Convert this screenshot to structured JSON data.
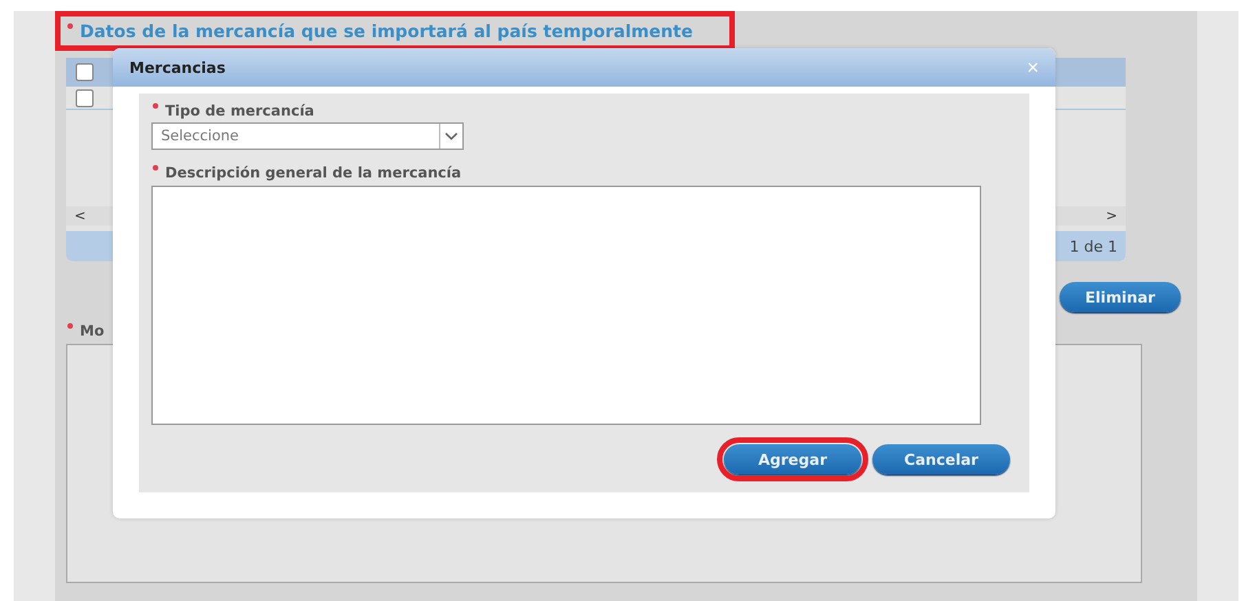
{
  "section": {
    "title": "Datos de la mercancía que se importará al país temporalmente",
    "required": true,
    "highlighted": true
  },
  "table": {
    "header_checkbox": {
      "checked": false
    },
    "rows": [
      {
        "checked": false
      }
    ],
    "pager": "1 de 1",
    "scroll_left": "<",
    "scroll_right": ">"
  },
  "delete_button": "Eliminar",
  "motive_field": {
    "label": "Mo",
    "required": true
  },
  "dialog": {
    "title": "Mercancias",
    "close": "×",
    "fields": [
      {
        "kind": "select",
        "label": "Tipo de mercancía",
        "required": true,
        "value": "Seleccione"
      },
      {
        "kind": "textarea",
        "label": "Descripción general de la mercancía",
        "required": true
      }
    ],
    "buttons": [
      {
        "label": "Agregar",
        "highlighted": true
      },
      {
        "label": "Cancelar",
        "highlighted": false
      }
    ]
  }
}
